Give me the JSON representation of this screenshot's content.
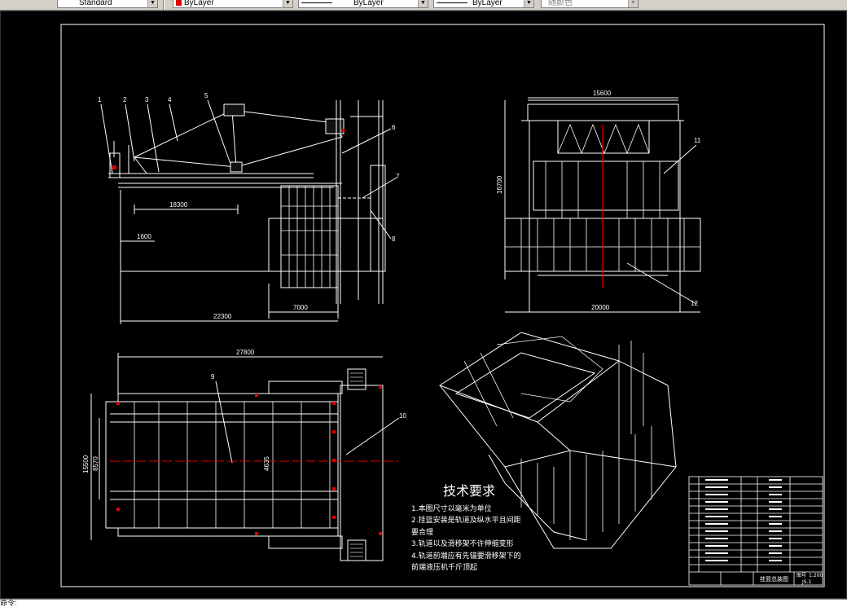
{
  "toolbar": {
    "textstyle": "Standard",
    "color": "ByLayer",
    "linetype": "ByLayer",
    "lineweight": "ByLayer",
    "plotstyle": "随颜色"
  },
  "drawing": {
    "dims": {
      "side_18300": "18300",
      "side_1600": "1600",
      "side_7000": "7000",
      "side_22300": "22300",
      "front_15600": "15600",
      "front_16700": "16700",
      "front_20000": "20000",
      "plan_27800": "27800",
      "plan_15500": "15500",
      "plan_8570": "8570",
      "plan_4635": "4635"
    },
    "callouts": [
      "1",
      "2",
      "3",
      "4",
      "5",
      "6",
      "7",
      "8",
      "9",
      "10",
      "11",
      "12"
    ],
    "tech_requirements": {
      "title": "技术要求",
      "lines": [
        "1.本图尺寸以毫米为单位",
        "2.挂篮安装是轨道及纵水平且间距",
        "要合理",
        "3.轨道以及滑移架不许伸缩变形",
        "4.轨道前端应有先锚要滑移架下的",
        "前端液压机千斤顶起"
      ]
    },
    "title_block": {
      "drawing_title": "挂篮总装图",
      "sheet": "图号",
      "scale": "1:200",
      "sheet_no": "JS.1"
    }
  },
  "statusbar": {
    "command_text": "命令:"
  }
}
